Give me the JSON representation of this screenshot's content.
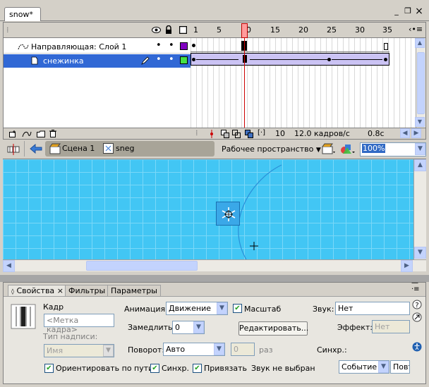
{
  "document": {
    "tab_title": "snow*"
  },
  "window_controls": {
    "minimize": "_",
    "restore": "❐",
    "close": "×"
  },
  "timeline": {
    "frame_numbers": [
      "1",
      "5",
      "10",
      "15",
      "20",
      "25",
      "30",
      "35"
    ],
    "layers": [
      {
        "name": "Направляющая: Слой 1",
        "type": "guide",
        "color": "#8000c0"
      },
      {
        "name": "снежинка",
        "type": "guided",
        "color": "#44e044",
        "selected": true
      }
    ],
    "footer": {
      "current_frame": "10",
      "frame_rate": "12.0 кадров/с",
      "elapsed": "0.8с"
    }
  },
  "edit_bar": {
    "scene": "Сцена 1",
    "symbol": "sneg",
    "workspace": "Рабочее пространство",
    "zoom": "100%"
  },
  "properties": {
    "tabs": [
      "Свойства",
      "Фильтры",
      "Параметры"
    ],
    "frame_label": "Кадр",
    "frame_name_placeholder": "<Метка кадра>",
    "label_type_label": "Тип надписи:",
    "label_type_value": "Имя",
    "tween_label": "Анимация:",
    "tween_value": "Движение",
    "scale_label": "Масштаб",
    "ease_label": "Замедлить:",
    "ease_value": "0",
    "edit_button": "Редактировать...",
    "rotate_label": "Поворот:",
    "rotate_value": "Авто",
    "rotate_times": "0",
    "times_label": "раз",
    "orient_label": "Ориентировать по пути",
    "sync_label": "Синхр.",
    "snap_label": "Привязать",
    "sound_label": "Звук:",
    "sound_value": "Нет",
    "effect_label": "Эффект:",
    "effect_value": "Нет",
    "sync2_label": "Синхр.:",
    "sound_status": "Звук не выбран",
    "event_value": "Событие",
    "repeat_value": "Повт"
  }
}
